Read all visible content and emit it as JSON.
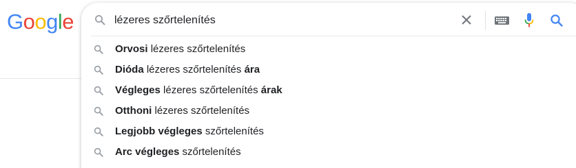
{
  "logo": {
    "letters": [
      "G",
      "o",
      "o",
      "g",
      "l",
      "e"
    ],
    "colors": [
      "#4285F4",
      "#EA4335",
      "#FBBC05",
      "#4285F4",
      "#34A853",
      "#EA4335"
    ]
  },
  "search": {
    "query": "lézeres szőrtelenítés",
    "icons": {
      "search": "search-icon",
      "clear": "close-icon",
      "keyboard": "keyboard-icon",
      "voice": "microphone-icon",
      "lens": "search-icon"
    }
  },
  "suggestions": [
    {
      "parts": [
        {
          "text": "Orvosi",
          "bold": true
        },
        {
          "text": " lézeres szőrtelenítés",
          "bold": false
        }
      ]
    },
    {
      "parts": [
        {
          "text": "Dióda",
          "bold": true
        },
        {
          "text": " lézeres szőrtelenítés ",
          "bold": false
        },
        {
          "text": "ára",
          "bold": true
        }
      ]
    },
    {
      "parts": [
        {
          "text": "Végleges",
          "bold": true
        },
        {
          "text": " lézeres szőrtelenítés ",
          "bold": false
        },
        {
          "text": "árak",
          "bold": true
        }
      ]
    },
    {
      "parts": [
        {
          "text": "Otthoni",
          "bold": true
        },
        {
          "text": " lézeres szőrtelenítés",
          "bold": false
        }
      ]
    },
    {
      "parts": [
        {
          "text": "Legjobb végleges",
          "bold": true
        },
        {
          "text": " szőrtelenítés",
          "bold": false
        }
      ]
    },
    {
      "parts": [
        {
          "text": "Arc végleges",
          "bold": true
        },
        {
          "text": " szőrtelenítés",
          "bold": false
        }
      ]
    }
  ],
  "colors": {
    "text": "#202124",
    "icon_gray": "#9aa0a6",
    "accent_blue": "#4285F4",
    "mic_red": "#EA4335"
  }
}
